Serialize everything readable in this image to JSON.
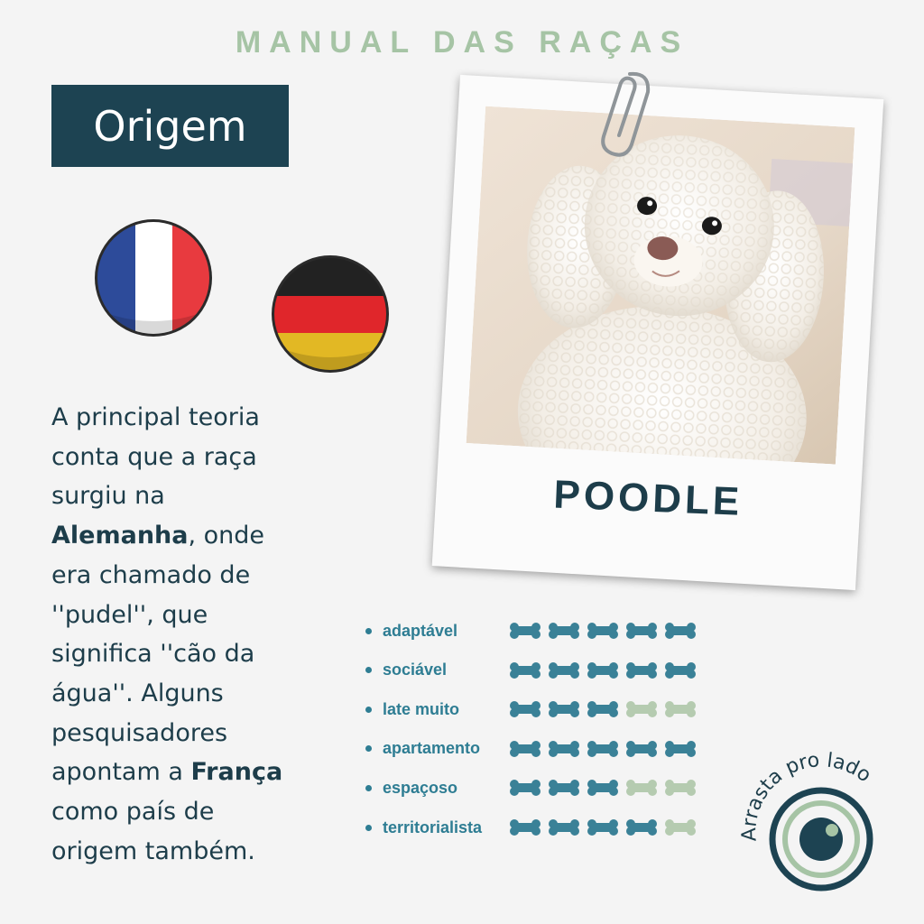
{
  "header": {
    "title": "MANUAL DAS RAÇAS"
  },
  "section": {
    "title": "Origem"
  },
  "flags": [
    {
      "icon": "france-flag-icon"
    },
    {
      "icon": "germany-flag-icon"
    }
  ],
  "description": {
    "line1": "A principal teoria",
    "line2": "conta que a raça",
    "line3": "surgiu na",
    "line4_bold": "Alemanha",
    "line4_rest": ", onde",
    "line5": "era chamado de",
    "line6": "''pudel'', que",
    "line7": "significa ''cão da",
    "line8": "água''. Alguns",
    "line9": "pesquisadores",
    "line10_start": "apontam a ",
    "line10_bold": "França",
    "line11": "como país de",
    "line12": "origem também."
  },
  "breed": {
    "name": "POODLE"
  },
  "traits": [
    {
      "label": "adaptável",
      "rating": 5
    },
    {
      "label": "sociável",
      "rating": 5
    },
    {
      "label": "late muito",
      "rating": 3
    },
    {
      "label": "apartamento",
      "rating": 5
    },
    {
      "label": "espaçoso",
      "rating": 3
    },
    {
      "label": "territorialista",
      "rating": 4
    }
  ],
  "rating_max": 5,
  "colors": {
    "filled_bone": "#3a8197",
    "empty_bone": "#b5cbb0",
    "accent": "#1d4352",
    "header": "#a6c4a5"
  },
  "swipe": {
    "text": "Arrasta pro lado",
    "icon": "swipe-eye-icon"
  }
}
